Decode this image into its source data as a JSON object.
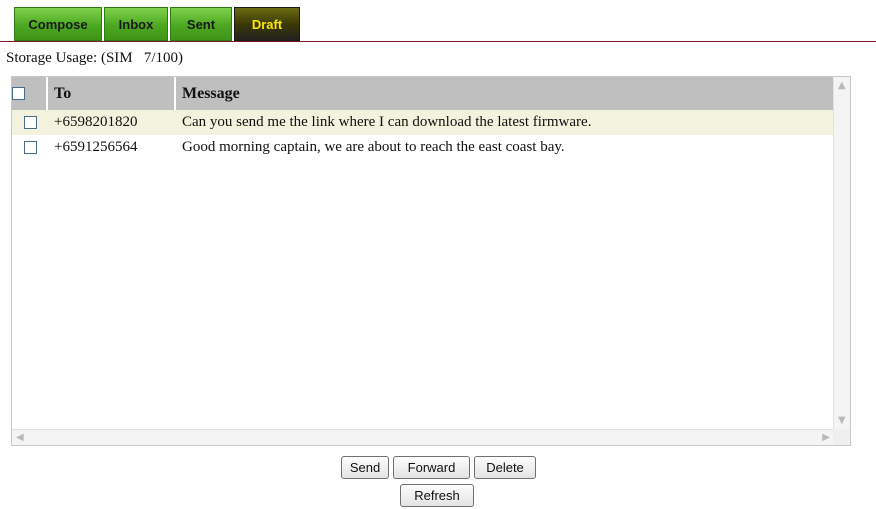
{
  "tabs": [
    {
      "label": "Compose",
      "active": false
    },
    {
      "label": "Inbox",
      "active": false
    },
    {
      "label": "Sent",
      "active": false
    },
    {
      "label": "Draft",
      "active": true
    }
  ],
  "storage_usage": "Storage Usage: (SIM   7/100)",
  "table": {
    "headers": [
      "To",
      "Message"
    ],
    "rows": [
      {
        "to": "+6598201820",
        "message": "Can you send me the link where I can download the latest firmware."
      },
      {
        "to": "+6591256564",
        "message": "Good morning captain, we are about to reach the east coast bay."
      }
    ]
  },
  "buttons": {
    "send": "Send",
    "forward": "Forward",
    "delete": "Delete",
    "refresh": "Refresh"
  },
  "colors": {
    "tab_green": "#4ca821",
    "tab_active_bg": "#3a3a06",
    "tab_active_text": "#ffe600",
    "header_bg": "#bfbfbf",
    "highlight_row": "#f3f2dd"
  }
}
